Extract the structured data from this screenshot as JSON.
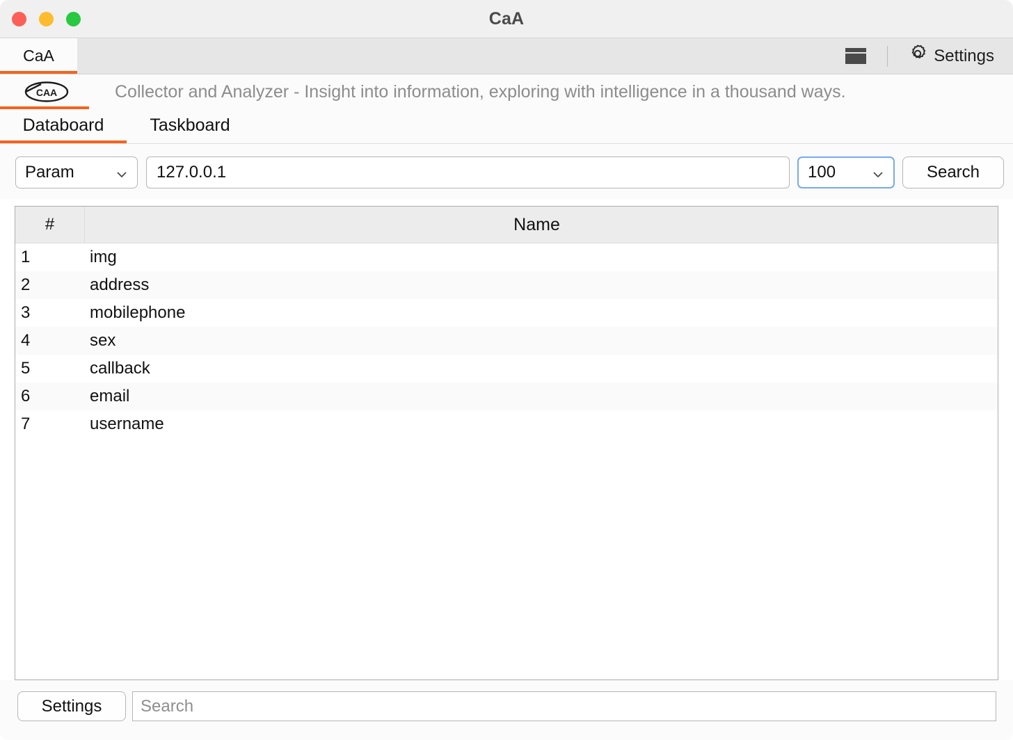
{
  "window": {
    "title": "CaA",
    "controls": [
      "close-button",
      "minimize-button",
      "maximize-button"
    ]
  },
  "toolbar": {
    "app_tab_label": "CaA",
    "panel_icon": "panel-layout-icon",
    "settings_icon": "gear-icon",
    "settings_label": "Settings"
  },
  "brand": {
    "logo_text": "CaA",
    "tagline": "Collector and Analyzer - Insight into information, exploring with intelligence in a thousand ways."
  },
  "board_tabs": [
    {
      "label": "Databoard",
      "active": true
    },
    {
      "label": "Taskboard",
      "active": false
    }
  ],
  "search_row": {
    "param_select": {
      "value": "Param",
      "caret_icon": "chevron-down-icon"
    },
    "url_input": {
      "value": "127.0.0.1",
      "placeholder": ""
    },
    "count_select": {
      "value": "100",
      "caret_icon": "chevron-down-icon",
      "focused": true
    },
    "search_button": "Search"
  },
  "table": {
    "columns": [
      "#",
      "Name"
    ],
    "rows": [
      {
        "num": "1",
        "name": "img"
      },
      {
        "num": "2",
        "name": "address"
      },
      {
        "num": "3",
        "name": "mobilephone"
      },
      {
        "num": "4",
        "name": "sex"
      },
      {
        "num": "5",
        "name": "callback"
      },
      {
        "num": "6",
        "name": "email"
      },
      {
        "num": "7",
        "name": "username"
      }
    ]
  },
  "bottom_bar": {
    "settings_button": "Settings",
    "search_placeholder": "Search",
    "search_value": ""
  },
  "colors": {
    "accent": "#f4631e",
    "focus_ring": "#76aaee",
    "titlebar": "#f0f0f0",
    "tabstrip": "#e6e6e6",
    "close": "#fc5f57",
    "minimize": "#fdbc2e",
    "maximize": "#28c840"
  }
}
